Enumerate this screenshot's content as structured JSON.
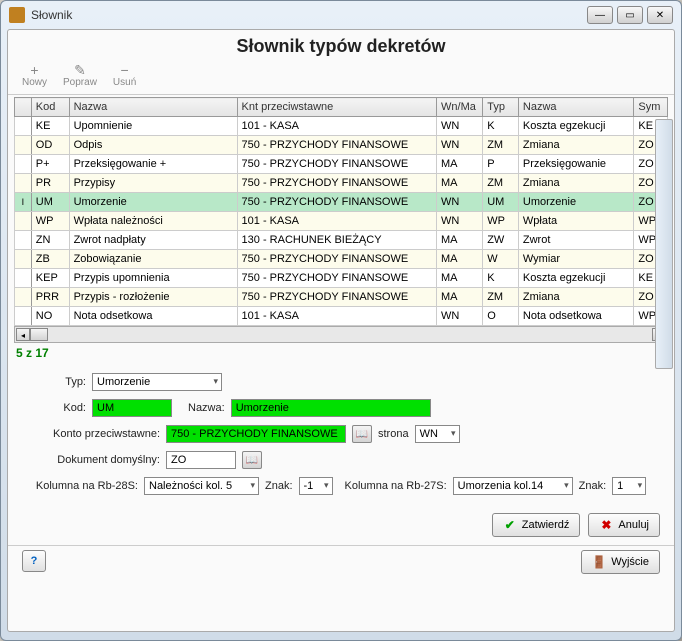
{
  "window": {
    "title": "Słownik"
  },
  "header": {
    "title": "Słownik typów dekretów"
  },
  "toolbar": {
    "new": "Nowy",
    "edit": "Popraw",
    "delete": "Usuń"
  },
  "table": {
    "columns": [
      "Kod",
      "Nazwa",
      "Knt przeciwstawne",
      "Wn/Ma",
      "Typ",
      "Nazwa",
      "Sym"
    ],
    "rows": [
      {
        "kod": "KE",
        "nazwa": "Upomnienie",
        "knt": "101 - KASA",
        "wnma": "WN",
        "typ": "K",
        "nazwa2": "Koszta egzekucji",
        "sym": "KE"
      },
      {
        "kod": "OD",
        "nazwa": "Odpis",
        "knt": "750 - PRZYCHODY FINANSOWE",
        "wnma": "WN",
        "typ": "ZM",
        "nazwa2": "Zmiana",
        "sym": "ZO"
      },
      {
        "kod": "P+",
        "nazwa": "Przeksięgowanie +",
        "knt": "750 - PRZYCHODY FINANSOWE",
        "wnma": "MA",
        "typ": "P",
        "nazwa2": "Przeksięgowanie",
        "sym": "ZO"
      },
      {
        "kod": "PR",
        "nazwa": "Przypisy",
        "knt": "750 - PRZYCHODY FINANSOWE",
        "wnma": "MA",
        "typ": "ZM",
        "nazwa2": "Zmiana",
        "sym": "ZO"
      },
      {
        "kod": "UM",
        "nazwa": "Umorzenie",
        "knt": "750 - PRZYCHODY FINANSOWE",
        "wnma": "WN",
        "typ": "UM",
        "nazwa2": "Umorzenie",
        "sym": "ZO",
        "selected": true
      },
      {
        "kod": "WP",
        "nazwa": "Wpłata należności",
        "knt": "101 - KASA",
        "wnma": "WN",
        "typ": "WP",
        "nazwa2": "Wpłata",
        "sym": "WP"
      },
      {
        "kod": "ZN",
        "nazwa": "Zwrot nadpłaty",
        "knt": "130 - RACHUNEK BIEŻĄCY",
        "wnma": "MA",
        "typ": "ZW",
        "nazwa2": "Zwrot",
        "sym": "WP"
      },
      {
        "kod": "ZB",
        "nazwa": "Zobowiązanie",
        "knt": "750 - PRZYCHODY FINANSOWE",
        "wnma": "MA",
        "typ": "W",
        "nazwa2": "Wymiar",
        "sym": "ZO"
      },
      {
        "kod": "KEP",
        "nazwa": "Przypis upomnienia",
        "knt": "750 - PRZYCHODY FINANSOWE",
        "wnma": "MA",
        "typ": "K",
        "nazwa2": "Koszta egzekucji",
        "sym": "KE"
      },
      {
        "kod": "PRR",
        "nazwa": "Przypis - rozłożenie",
        "knt": "750 - PRZYCHODY FINANSOWE",
        "wnma": "MA",
        "typ": "ZM",
        "nazwa2": "Zmiana",
        "sym": "ZO"
      },
      {
        "kod": "NO",
        "nazwa": "Nota odsetkowa",
        "knt": "101 - KASA",
        "wnma": "WN",
        "typ": "O",
        "nazwa2": "Nota odsetkowa",
        "sym": "WP"
      }
    ]
  },
  "counter": "5 z 17",
  "form": {
    "typ_label": "Typ:",
    "typ_value": "Umorzenie",
    "kod_label": "Kod:",
    "kod_value": "UM",
    "nazwa_label": "Nazwa:",
    "nazwa_value": "Umorzenie",
    "konto_label": "Konto przeciwstawne:",
    "konto_value": "750 - PRZYCHODY FINANSOWE",
    "strona_label": "strona",
    "strona_value": "WN",
    "dok_label": "Dokument domyślny:",
    "dok_value": "ZO",
    "kol28_label": "Kolumna na Rb-28S:",
    "kol28_value": "Należności kol. 5",
    "znak1_label": "Znak:",
    "znak1_value": "-1",
    "kol27_label": "Kolumna na Rb-27S:",
    "kol27_value": "Umorzenia kol.14",
    "znak2_label": "Znak:",
    "znak2_value": "1"
  },
  "buttons": {
    "confirm": "Zatwierdź",
    "cancel": "Anuluj",
    "exit": "Wyjście"
  }
}
